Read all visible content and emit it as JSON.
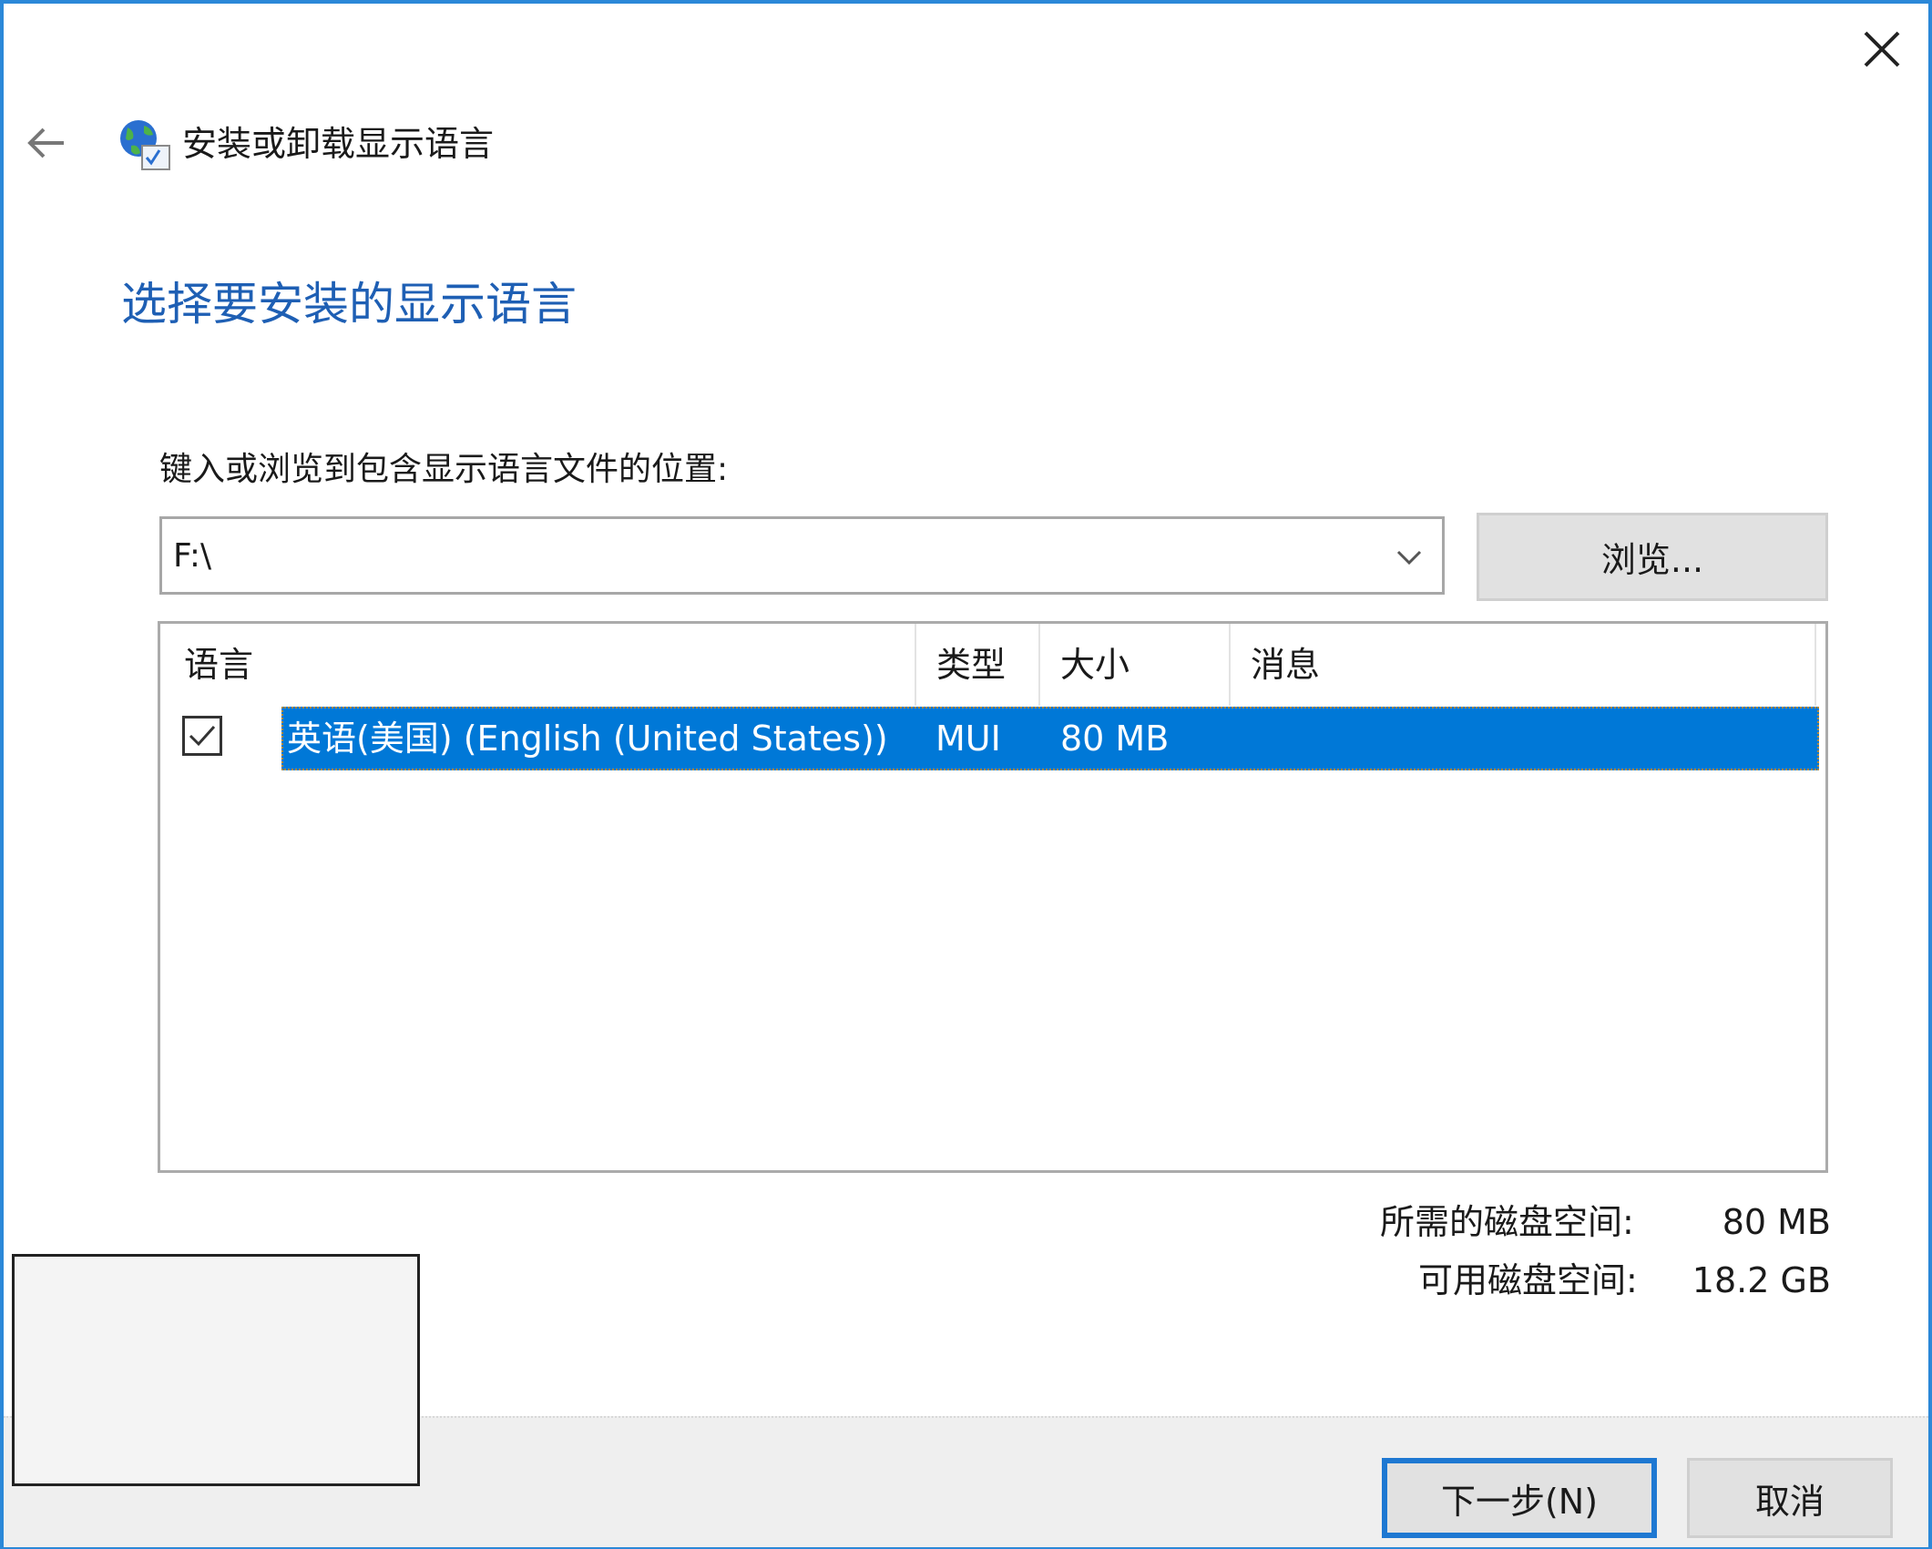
{
  "window": {
    "title": "安装或卸载显示语言",
    "close_icon": "close-icon",
    "back_icon": "back-arrow-icon",
    "app_icon": "globe-language-icon"
  },
  "page": {
    "heading": "选择要安装的显示语言",
    "location_label": "键入或浏览到包含显示语言文件的位置:",
    "location_value": "F:\\",
    "browse_label": "浏览..."
  },
  "list": {
    "columns": [
      "语言",
      "类型",
      "大小",
      "消息"
    ],
    "rows": [
      {
        "checked": true,
        "language": "英语(美国) (English (United States))",
        "type": "MUI",
        "size": "80 MB",
        "message": ""
      }
    ]
  },
  "space": {
    "required_label": "所需的磁盘空间:",
    "required_value": "80 MB",
    "available_label": "可用磁盘空间:",
    "available_value": "18.2 GB"
  },
  "footer": {
    "next_label": "下一步(N)",
    "cancel_label": "取消"
  },
  "colors": {
    "accent": "#0078d7",
    "heading": "#1e5fb4",
    "border": "#2b88d8"
  }
}
